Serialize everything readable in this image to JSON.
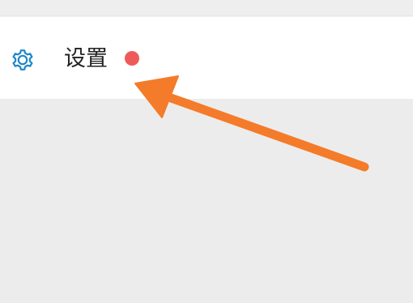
{
  "settings_item": {
    "label": "设置",
    "icon": "gear-icon",
    "icon_color": "#1f86c8",
    "badge_color": "#ee5a5a"
  },
  "annotation": {
    "arrow_color": "#f47b2a"
  }
}
